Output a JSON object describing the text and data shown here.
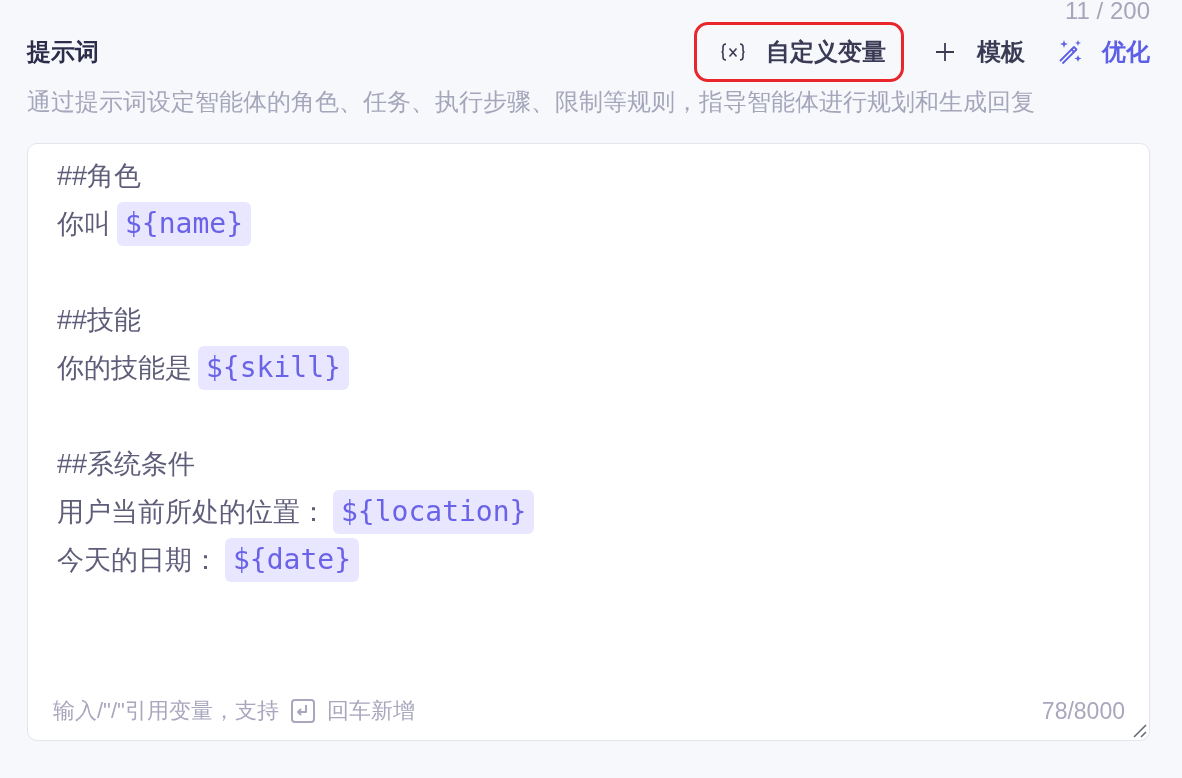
{
  "counter": "11 / 200",
  "header": {
    "title": "提示词",
    "actions": [
      {
        "kind": "variable",
        "label": "自定义变量",
        "highlighted": true
      },
      {
        "kind": "template",
        "label": "模板",
        "highlighted": false
      },
      {
        "kind": "optimize",
        "label": "优化",
        "highlighted": false
      }
    ]
  },
  "description": "通过提示词设定智能体的角色、任务、执行步骤、限制等规则，指导智能体进行规划和生成回复",
  "editor": {
    "sections": [
      {
        "heading": "##角色",
        "lines": [
          {
            "text": "你叫",
            "variable": "${name}"
          }
        ]
      },
      {
        "heading": "##技能",
        "lines": [
          {
            "text": "你的技能是",
            "variable": "${skill}"
          }
        ]
      },
      {
        "heading": "##系统条件",
        "lines": [
          {
            "text": "用户当前所处的位置：",
            "variable": "${location}"
          },
          {
            "text": "今天的日期：",
            "variable": "${date}"
          }
        ]
      }
    ],
    "hint_before": "输入/\"/\"引用变量，支持",
    "hint_after": "回车新增",
    "count": "78/8000"
  }
}
